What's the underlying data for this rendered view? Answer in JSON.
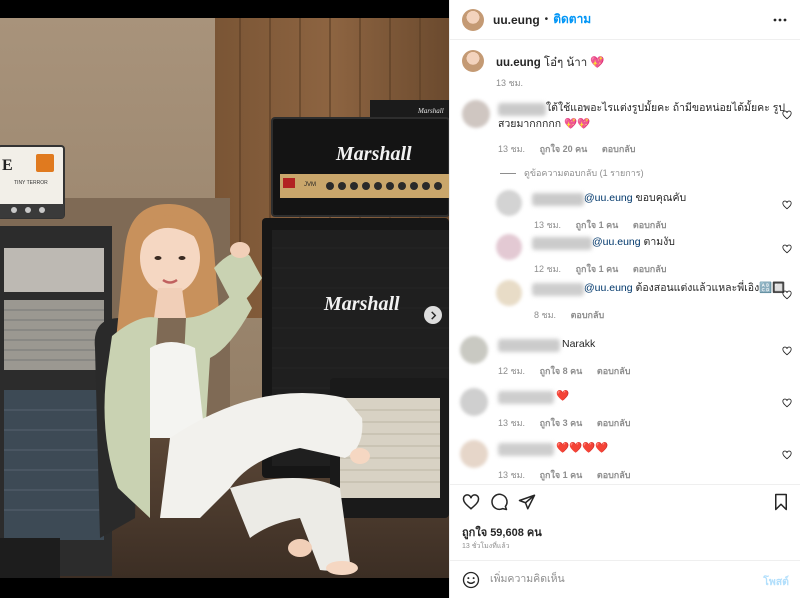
{
  "post": {
    "author": "uu.eung",
    "separator": "•",
    "follow_label": "ติดตาม",
    "caption_text": "โอ๋ๆ น้าา 💖",
    "caption_time": "13 ชม.",
    "likes_label": "ถูกใจ 59,608 คน",
    "posted_time": "13 ชั่วโมงที่แล้ว",
    "comment_placeholder": "เพิ่มความคิดเห็น",
    "post_label": "โพสต์"
  },
  "comments": [
    {
      "text_line1": "ใต้ใช้แอพอะไรแต่งรูปมั้ยคะ ถ้ามีขอหน่อยได้มั้ยคะ รูป",
      "text_line2": "สวยมากกกกก 💖💖",
      "time": "13 ชม.",
      "likes": "ถูกใจ 20 คน",
      "reply": "ตอบกลับ"
    }
  ],
  "view_replies": "ดูข้อความตอบกลับ (1 รายการ)",
  "replies": [
    {
      "mention": "@uu.eung",
      "text": " ขอบคุณคับ",
      "time": "13 ชม.",
      "likes": "ถูกใจ 1 คน",
      "reply": "ตอบกลับ"
    },
    {
      "mention": "@uu.eung",
      "text": " ตามงับ",
      "time": "12 ชม.",
      "likes": "ถูกใจ 1 คน",
      "reply": "ตอบกลับ"
    },
    {
      "mention": "@uu.eung",
      "text": " ต้องสอนแต่งแล้วแหละพี่เอิง🔠🔲",
      "time": "8 ชม.",
      "reply": "ตอบกลับ"
    }
  ],
  "more_comments": [
    {
      "text": "Narakk",
      "time": "12 ชม.",
      "likes": "ถูกใจ 8 คน",
      "reply": "ตอบกลับ"
    },
    {
      "text": "❤️",
      "time": "13 ชม.",
      "likes": "ถูกใจ 3 คน",
      "reply": "ตอบกลับ"
    },
    {
      "text": "❤️❤️❤️❤️",
      "time": "13 ชม.",
      "likes": "ถูกใจ 1 คน",
      "reply": "ตอบกลับ"
    }
  ],
  "photo_signage": {
    "brand_top": "Marshall",
    "brand_bottom": "Marshall",
    "amp_small": "Marshall",
    "amp_model": "JVM",
    "orange_amp": "TINY TERROR",
    "orange_letter": "E"
  },
  "colors": {
    "accent": "#0095f6",
    "mention": "#00376b",
    "muted": "#8e8e8e",
    "text": "#262626",
    "post_disabled": "#b2dffc"
  },
  "icons": {
    "more": "more-horizontal-icon",
    "heart": "heart-icon",
    "comment": "comment-icon",
    "share": "share-icon",
    "save": "bookmark-icon",
    "emoji": "emoji-icon",
    "next": "chevron-right-icon"
  }
}
